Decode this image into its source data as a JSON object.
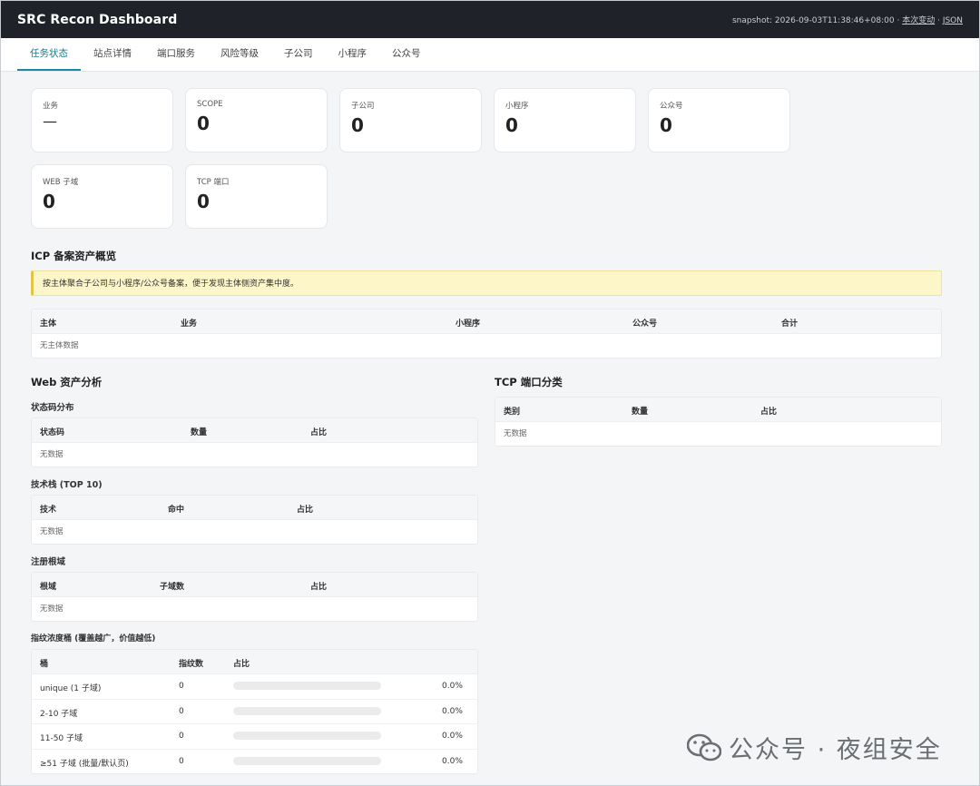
{
  "header": {
    "title": "SRC Recon Dashboard",
    "snapshot": "snapshot: 2026-09-03T11:38:46+08:00 · ",
    "link_this": "本次变动",
    "sep": " · ",
    "link_json": "JSON"
  },
  "tabs": [
    {
      "label": "任务状态",
      "active": true
    },
    {
      "label": "站点详情"
    },
    {
      "label": "端口服务"
    },
    {
      "label": "风险等级"
    },
    {
      "label": "子公司"
    },
    {
      "label": "小程序"
    },
    {
      "label": "公众号"
    }
  ],
  "stats": [
    {
      "label": "业务",
      "value": "—"
    },
    {
      "label": "SCOPE",
      "value": "0"
    },
    {
      "label": "子公司",
      "value": "0"
    },
    {
      "label": "小程序",
      "value": "0"
    },
    {
      "label": "公众号",
      "value": "0"
    },
    {
      "label": "WEB 子域",
      "value": "0"
    },
    {
      "label": "TCP 端口",
      "value": "0"
    }
  ],
  "icp": {
    "title": "ICP 备案资产概览",
    "notice": "按主体聚合子公司与小程序/公众号备案，便于发现主体侧资产集中度。",
    "headers": [
      "主体",
      "业务",
      "小程序",
      "公众号",
      "合计"
    ],
    "empty": "无主体数据"
  },
  "web": {
    "title": "Web 资产分析",
    "status": {
      "title": "状态码分布",
      "headers": [
        "状态码",
        "数量",
        "占比"
      ],
      "empty": "无数据"
    },
    "tech": {
      "title": "技术栈 (TOP 10)",
      "headers": [
        "技术",
        "命中",
        "占比"
      ],
      "empty": "无数据"
    },
    "roots": {
      "title": "注册根域",
      "headers": [
        "根域",
        "子域数",
        "占比"
      ],
      "empty": "无数据"
    },
    "buckets": {
      "title": "指纹浓度桶 (覆盖越广，价值越低)",
      "headers": [
        "桶",
        "指纹数",
        "占比"
      ],
      "rows": [
        {
          "name": "unique (1 子域)",
          "count": "0",
          "pct": "0.0%",
          "fill": 0
        },
        {
          "name": "2-10 子域",
          "count": "0",
          "pct": "0.0%",
          "fill": 0
        },
        {
          "name": "11-50 子域",
          "count": "0",
          "pct": "0.0%",
          "fill": 0
        },
        {
          "name": "≥51 子域 (批量/默认页)",
          "count": "0",
          "pct": "0.0%",
          "fill": 0
        }
      ]
    }
  },
  "tcp": {
    "title": "TCP 端口分类",
    "headers": [
      "类别",
      "数量",
      "占比"
    ],
    "empty": "无数据"
  },
  "watermark": "公众号 · 夜组安全"
}
